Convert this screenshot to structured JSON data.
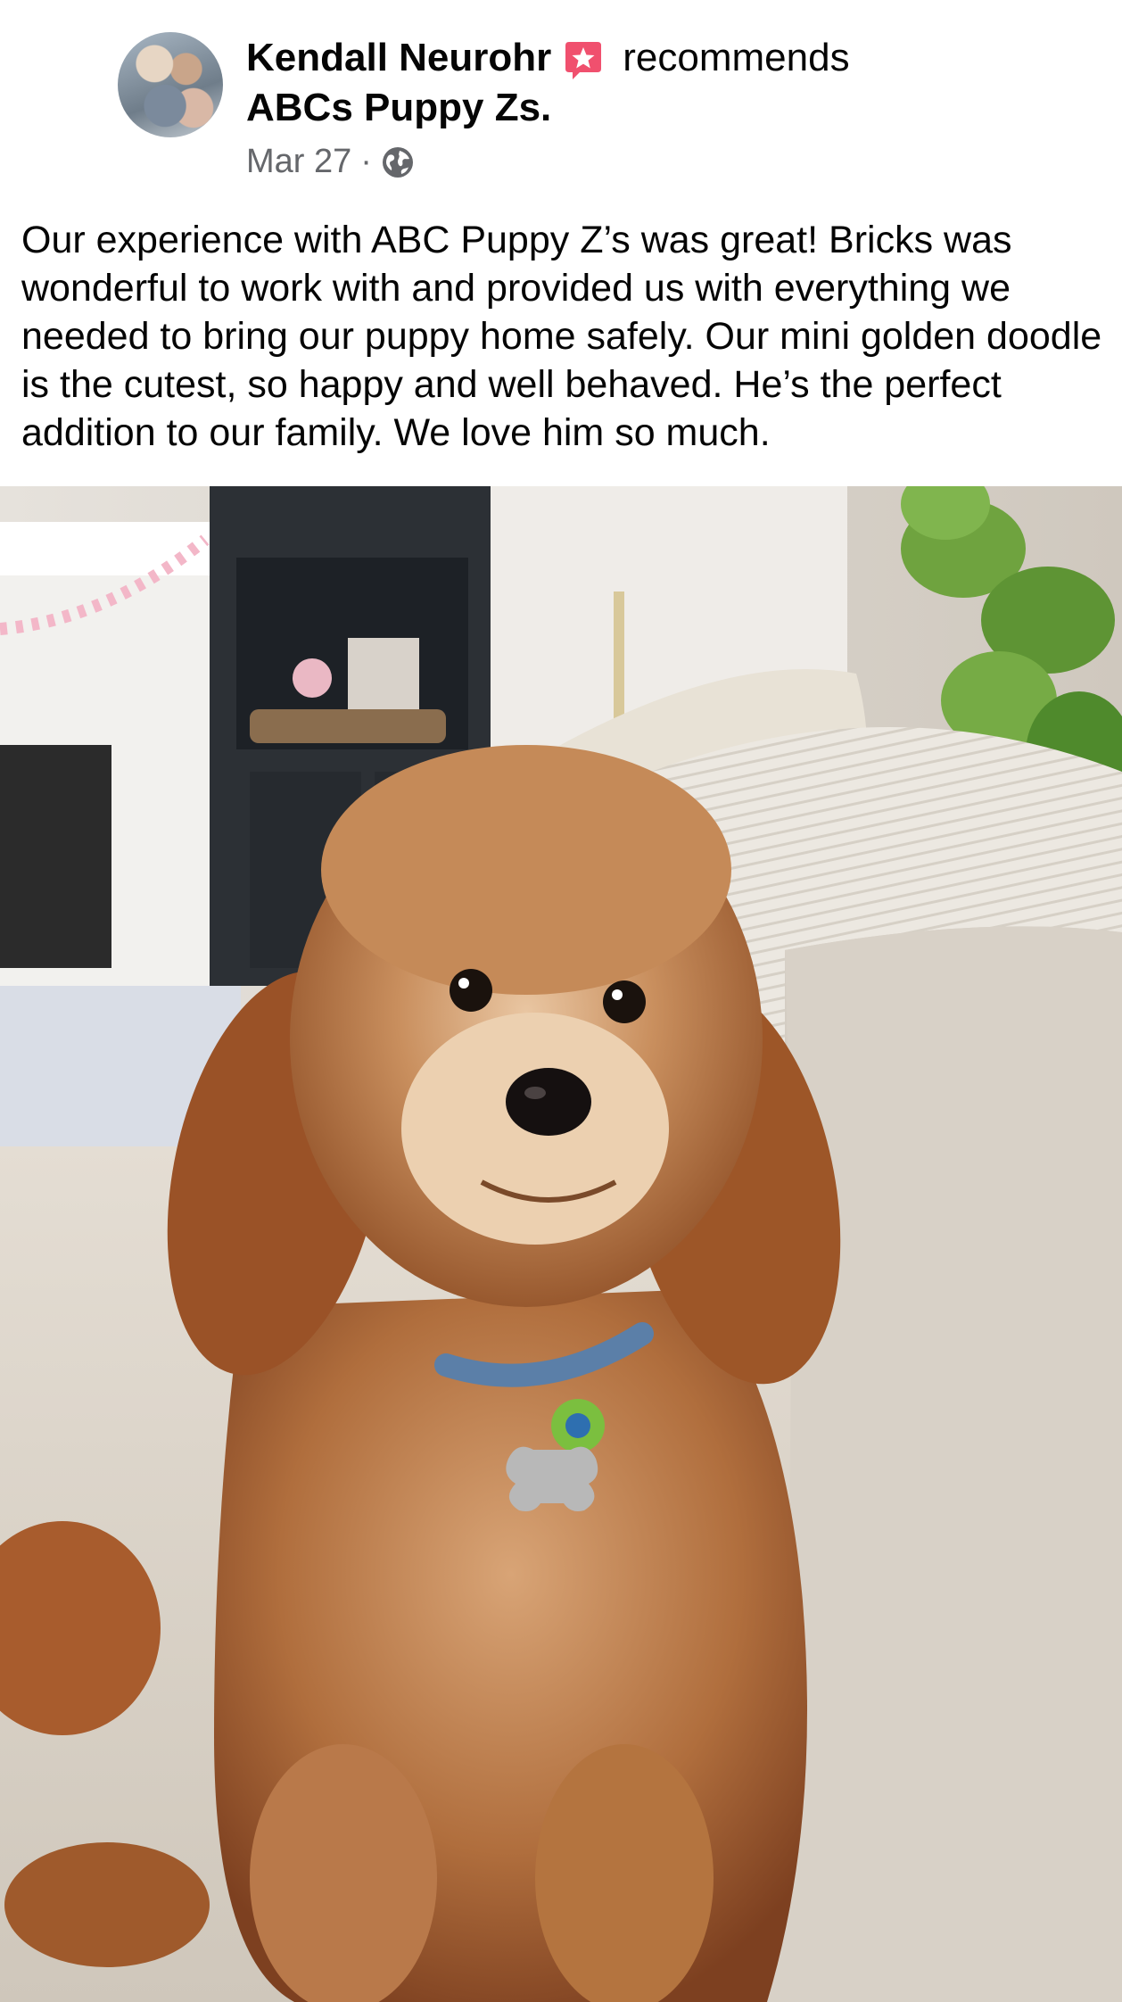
{
  "post": {
    "author": "Kendall Neurohr",
    "action": "recommends",
    "page_name": "ABCs Puppy Zs.",
    "date": "Mar 27",
    "separator": "·",
    "audience_icon": "globe-icon",
    "recommend_icon": "recommend-star-icon",
    "text": "Our experience with ABC Puppy Z’s was great! Bricks was wonderful to work with and provided us with everything we needed to bring our puppy home safely. Our mini golden doodle is the cutest, so happy and well behaved. He’s the perfect addition to our family. We love him so much."
  },
  "colors": {
    "text": "#050505",
    "secondary_text": "#65676b",
    "recommend_badge": "#f0506e"
  }
}
